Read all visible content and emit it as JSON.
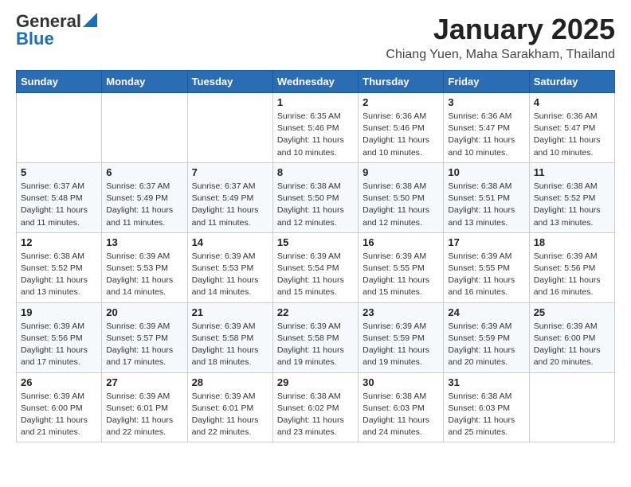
{
  "header": {
    "logo_general": "General",
    "logo_blue": "Blue",
    "month_title": "January 2025",
    "location": "Chiang Yuen, Maha Sarakham, Thailand"
  },
  "days_of_week": [
    "Sunday",
    "Monday",
    "Tuesday",
    "Wednesday",
    "Thursday",
    "Friday",
    "Saturday"
  ],
  "weeks": [
    [
      {
        "day": "",
        "info": ""
      },
      {
        "day": "",
        "info": ""
      },
      {
        "day": "",
        "info": ""
      },
      {
        "day": "1",
        "info": "Sunrise: 6:35 AM\nSunset: 5:46 PM\nDaylight: 11 hours and 10 minutes."
      },
      {
        "day": "2",
        "info": "Sunrise: 6:36 AM\nSunset: 5:46 PM\nDaylight: 11 hours and 10 minutes."
      },
      {
        "day": "3",
        "info": "Sunrise: 6:36 AM\nSunset: 5:47 PM\nDaylight: 11 hours and 10 minutes."
      },
      {
        "day": "4",
        "info": "Sunrise: 6:36 AM\nSunset: 5:47 PM\nDaylight: 11 hours and 10 minutes."
      }
    ],
    [
      {
        "day": "5",
        "info": "Sunrise: 6:37 AM\nSunset: 5:48 PM\nDaylight: 11 hours and 11 minutes."
      },
      {
        "day": "6",
        "info": "Sunrise: 6:37 AM\nSunset: 5:49 PM\nDaylight: 11 hours and 11 minutes."
      },
      {
        "day": "7",
        "info": "Sunrise: 6:37 AM\nSunset: 5:49 PM\nDaylight: 11 hours and 11 minutes."
      },
      {
        "day": "8",
        "info": "Sunrise: 6:38 AM\nSunset: 5:50 PM\nDaylight: 11 hours and 12 minutes."
      },
      {
        "day": "9",
        "info": "Sunrise: 6:38 AM\nSunset: 5:50 PM\nDaylight: 11 hours and 12 minutes."
      },
      {
        "day": "10",
        "info": "Sunrise: 6:38 AM\nSunset: 5:51 PM\nDaylight: 11 hours and 13 minutes."
      },
      {
        "day": "11",
        "info": "Sunrise: 6:38 AM\nSunset: 5:52 PM\nDaylight: 11 hours and 13 minutes."
      }
    ],
    [
      {
        "day": "12",
        "info": "Sunrise: 6:38 AM\nSunset: 5:52 PM\nDaylight: 11 hours and 13 minutes."
      },
      {
        "day": "13",
        "info": "Sunrise: 6:39 AM\nSunset: 5:53 PM\nDaylight: 11 hours and 14 minutes."
      },
      {
        "day": "14",
        "info": "Sunrise: 6:39 AM\nSunset: 5:53 PM\nDaylight: 11 hours and 14 minutes."
      },
      {
        "day": "15",
        "info": "Sunrise: 6:39 AM\nSunset: 5:54 PM\nDaylight: 11 hours and 15 minutes."
      },
      {
        "day": "16",
        "info": "Sunrise: 6:39 AM\nSunset: 5:55 PM\nDaylight: 11 hours and 15 minutes."
      },
      {
        "day": "17",
        "info": "Sunrise: 6:39 AM\nSunset: 5:55 PM\nDaylight: 11 hours and 16 minutes."
      },
      {
        "day": "18",
        "info": "Sunrise: 6:39 AM\nSunset: 5:56 PM\nDaylight: 11 hours and 16 minutes."
      }
    ],
    [
      {
        "day": "19",
        "info": "Sunrise: 6:39 AM\nSunset: 5:56 PM\nDaylight: 11 hours and 17 minutes."
      },
      {
        "day": "20",
        "info": "Sunrise: 6:39 AM\nSunset: 5:57 PM\nDaylight: 11 hours and 17 minutes."
      },
      {
        "day": "21",
        "info": "Sunrise: 6:39 AM\nSunset: 5:58 PM\nDaylight: 11 hours and 18 minutes."
      },
      {
        "day": "22",
        "info": "Sunrise: 6:39 AM\nSunset: 5:58 PM\nDaylight: 11 hours and 19 minutes."
      },
      {
        "day": "23",
        "info": "Sunrise: 6:39 AM\nSunset: 5:59 PM\nDaylight: 11 hours and 19 minutes."
      },
      {
        "day": "24",
        "info": "Sunrise: 6:39 AM\nSunset: 5:59 PM\nDaylight: 11 hours and 20 minutes."
      },
      {
        "day": "25",
        "info": "Sunrise: 6:39 AM\nSunset: 6:00 PM\nDaylight: 11 hours and 20 minutes."
      }
    ],
    [
      {
        "day": "26",
        "info": "Sunrise: 6:39 AM\nSunset: 6:00 PM\nDaylight: 11 hours and 21 minutes."
      },
      {
        "day": "27",
        "info": "Sunrise: 6:39 AM\nSunset: 6:01 PM\nDaylight: 11 hours and 22 minutes."
      },
      {
        "day": "28",
        "info": "Sunrise: 6:39 AM\nSunset: 6:01 PM\nDaylight: 11 hours and 22 minutes."
      },
      {
        "day": "29",
        "info": "Sunrise: 6:38 AM\nSunset: 6:02 PM\nDaylight: 11 hours and 23 minutes."
      },
      {
        "day": "30",
        "info": "Sunrise: 6:38 AM\nSunset: 6:03 PM\nDaylight: 11 hours and 24 minutes."
      },
      {
        "day": "31",
        "info": "Sunrise: 6:38 AM\nSunset: 6:03 PM\nDaylight: 11 hours and 25 minutes."
      },
      {
        "day": "",
        "info": ""
      }
    ]
  ]
}
